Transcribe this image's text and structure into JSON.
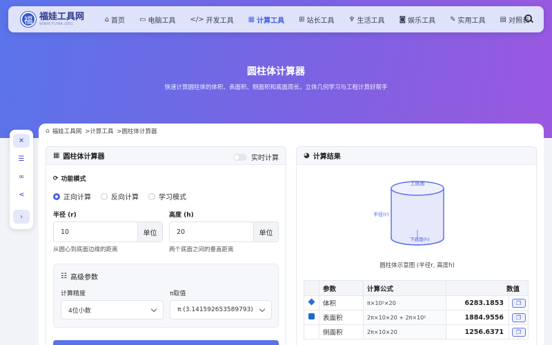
{
  "header": {
    "logo_glyph": "福",
    "site_name": "福娃工具网",
    "site_domain": "WWW.FUWA.ORG",
    "nav": [
      {
        "icon": "home-icon",
        "glyph": "⌂",
        "label": "首页"
      },
      {
        "icon": "desktop-icon",
        "glyph": "▭",
        "label": "电脑工具"
      },
      {
        "icon": "code-icon",
        "glyph": "</>",
        "label": "开发工具"
      },
      {
        "icon": "calculator-icon",
        "glyph": "▦",
        "label": "计算工具",
        "active": true
      },
      {
        "icon": "sitemap-icon",
        "glyph": "⊞",
        "label": "站长工具"
      },
      {
        "icon": "utensils-icon",
        "glyph": "♆",
        "label": "生活工具"
      },
      {
        "icon": "gamepad-icon",
        "glyph": "◙",
        "label": "娱乐工具"
      },
      {
        "icon": "wrench-icon",
        "glyph": "✎",
        "label": "实用工具"
      },
      {
        "icon": "table-icon",
        "glyph": "▤",
        "label": "对照表"
      }
    ]
  },
  "hero": {
    "title": "圆柱体计算器",
    "description": "快速计算圆柱体的体积、表面积、侧面积和底面周长，立体几何学习与工程计算好帮手"
  },
  "sidebar": [
    "tools-icon",
    "list-icon",
    "link-icon",
    "share-icon",
    "chevron-right-icon"
  ],
  "breadcrumb": {
    "items": [
      "福娃工具网",
      ">计算工具",
      ">圆柱体计算器"
    ]
  },
  "calculator": {
    "title": "圆柱体计算器",
    "live_label": "实时计算",
    "mode_title": "功能模式",
    "modes": [
      "正向计算",
      "反向计算",
      "学习模式"
    ],
    "selected_mode": 0,
    "radius": {
      "label": "半径 (r)",
      "value": "10",
      "unit": "单位",
      "hint": "从圆心到底面边缘的距离"
    },
    "height": {
      "label": "高度 (h)",
      "value": "20",
      "unit": "单位",
      "hint": "两个底面之间的垂直距离"
    },
    "advanced": {
      "title": "高级参数",
      "precision_label": "计算精度",
      "precision_value": "4位小数",
      "pi_label": "π取值",
      "pi_value": "π (3.141592653589793)"
    }
  },
  "results": {
    "title": "计算结果",
    "diagram": {
      "top_label": "上底面",
      "side_label": "半径(r)",
      "bottom_label": "下底面(h)"
    },
    "caption": "圆柱体示意图 (半径r, 高度h)",
    "columns": [
      "参数",
      "计算公式",
      "数值"
    ],
    "rows": [
      {
        "icon": "cube-icon",
        "name": "体积",
        "formula": "π×10²×20",
        "value": "6283.1853"
      },
      {
        "icon": "square-icon",
        "name": "表面积",
        "formula": "2π×10×20 + 2π×10²",
        "value": "1884.9556"
      },
      {
        "icon": "",
        "name": "侧面积",
        "formula": "2π×10×20",
        "value": "1256.6371"
      }
    ]
  }
}
